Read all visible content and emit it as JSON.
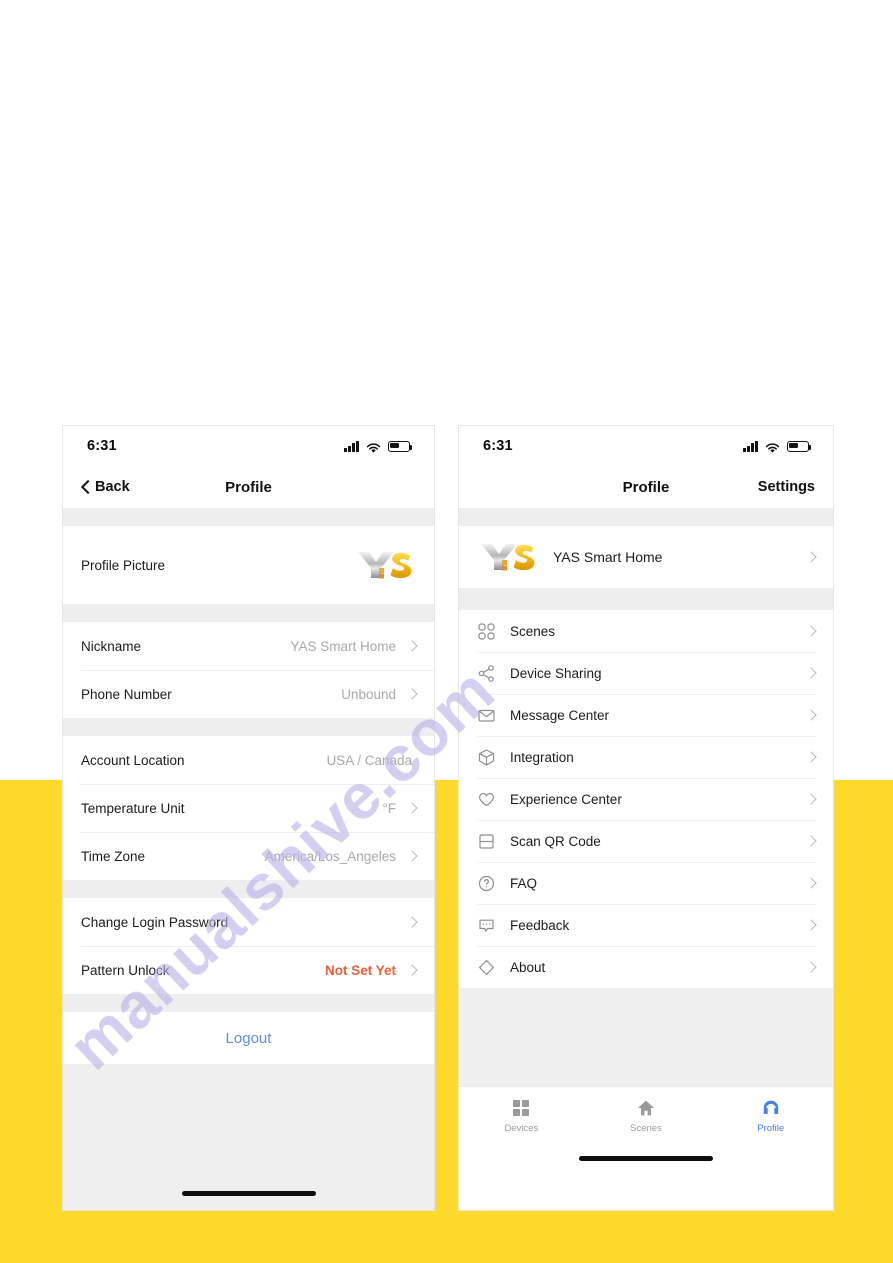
{
  "page": {
    "background_color": "#ffffff",
    "frame_color": "#FCD92B",
    "watermark": "manualshive.com",
    "watermark_color": "#b9b2e8"
  },
  "left_phone": {
    "status_bar": {
      "time": "6:31",
      "signal_icon": "cellular-signal-icon",
      "wifi_icon": "wifi-icon",
      "battery_icon": "battery-icon"
    },
    "nav": {
      "back_label": "Back",
      "title": "Profile"
    },
    "sections": [
      {
        "rows": [
          {
            "label": "Profile Picture",
            "value": "",
            "type": "avatar",
            "avatar": "yas-logo"
          }
        ]
      },
      {
        "rows": [
          {
            "label": "Nickname",
            "value": "YAS Smart Home",
            "type": "link"
          },
          {
            "label": "Phone Number",
            "value": "Unbound",
            "type": "link"
          }
        ]
      },
      {
        "rows": [
          {
            "label": "Account Location",
            "value": "USA / Canada",
            "type": "plain"
          },
          {
            "label": "Temperature Unit",
            "value": "°F",
            "type": "link"
          },
          {
            "label": "Time Zone",
            "value": "America/Los_Angeles",
            "type": "link"
          }
        ]
      },
      {
        "rows": [
          {
            "label": "Change Login Password",
            "value": "",
            "type": "link"
          },
          {
            "label": "Pattern Unlock",
            "value": "Not Set Yet",
            "type": "link-accent"
          }
        ]
      }
    ],
    "logout_label": "Logout",
    "accent_color": "#e8603a",
    "logout_color": "#5f8fe0"
  },
  "right_phone": {
    "status_bar": {
      "time": "6:31",
      "signal_icon": "cellular-signal-icon",
      "wifi_icon": "wifi-icon",
      "battery_icon": "battery-icon"
    },
    "nav": {
      "title": "Profile",
      "right_label": "Settings"
    },
    "account": {
      "name": "YAS Smart Home",
      "avatar": "yas-logo"
    },
    "menu": [
      {
        "label": "Scenes",
        "icon": "scenes-grid-icon"
      },
      {
        "label": "Device Sharing",
        "icon": "share-icon"
      },
      {
        "label": "Message Center",
        "icon": "envelope-icon"
      },
      {
        "label": "Integration",
        "icon": "cube-icon"
      },
      {
        "label": "Experience Center",
        "icon": "heart-icon"
      },
      {
        "label": "Scan QR Code",
        "icon": "scan-lines-icon"
      },
      {
        "label": "FAQ",
        "icon": "question-circle-icon"
      },
      {
        "label": "Feedback",
        "icon": "feedback-bubble-icon"
      },
      {
        "label": "About",
        "icon": "diamond-icon"
      }
    ],
    "tabs": [
      {
        "label": "Devices",
        "icon": "grid-squares-icon",
        "active": false
      },
      {
        "label": "Scenes",
        "icon": "home-icon",
        "active": false
      },
      {
        "label": "Profile",
        "icon": "headset-icon",
        "active": true
      }
    ],
    "active_tab_color": "#4a7fe0"
  }
}
